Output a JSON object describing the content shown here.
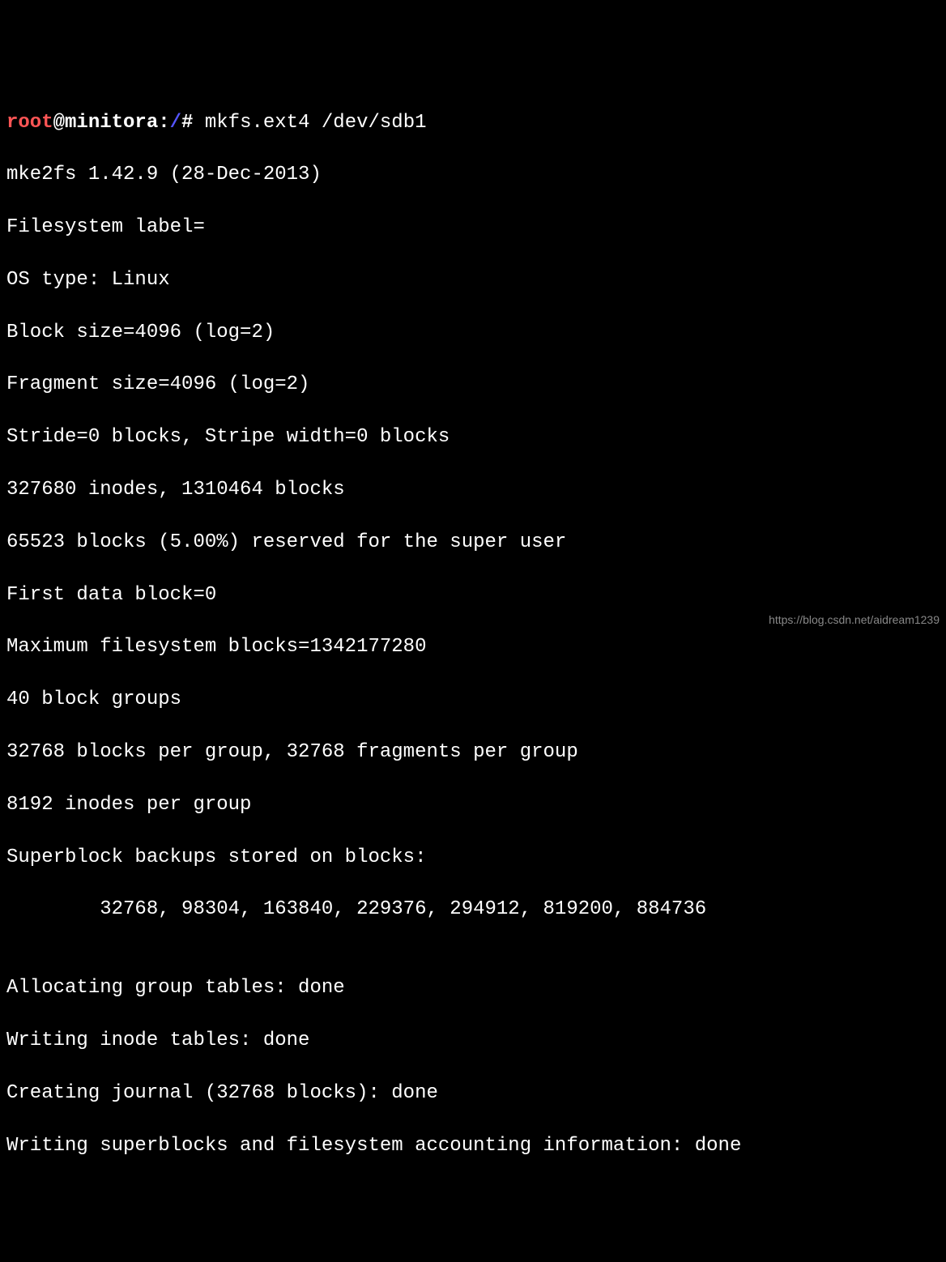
{
  "prompt": {
    "user": "root",
    "at": "@",
    "host": "minitora",
    "sep": ":",
    "path": "/",
    "hash": "# ",
    "command": "mkfs.ext4 /dev/sdb1"
  },
  "output_lines": [
    "mke2fs 1.42.9 (28-Dec-2013)",
    "Filesystem label=",
    "OS type: Linux",
    "Block size=4096 (log=2)",
    "Fragment size=4096 (log=2)",
    "Stride=0 blocks, Stripe width=0 blocks",
    "327680 inodes, 1310464 blocks",
    "65523 blocks (5.00%) reserved for the super user",
    "First data block=0",
    "Maximum filesystem blocks=1342177280",
    "40 block groups",
    "32768 blocks per group, 32768 fragments per group",
    "8192 inodes per group",
    "Superblock backups stored on blocks: ",
    "        32768, 98304, 163840, 229376, 294912, 819200, 884736",
    "",
    "Allocating group tables: done",
    "Writing inode tables: done",
    "Creating journal (32768 blocks): done",
    "Writing superblocks and filesystem accounting information: done"
  ],
  "watermark": "https://blog.csdn.net/aidream1239"
}
